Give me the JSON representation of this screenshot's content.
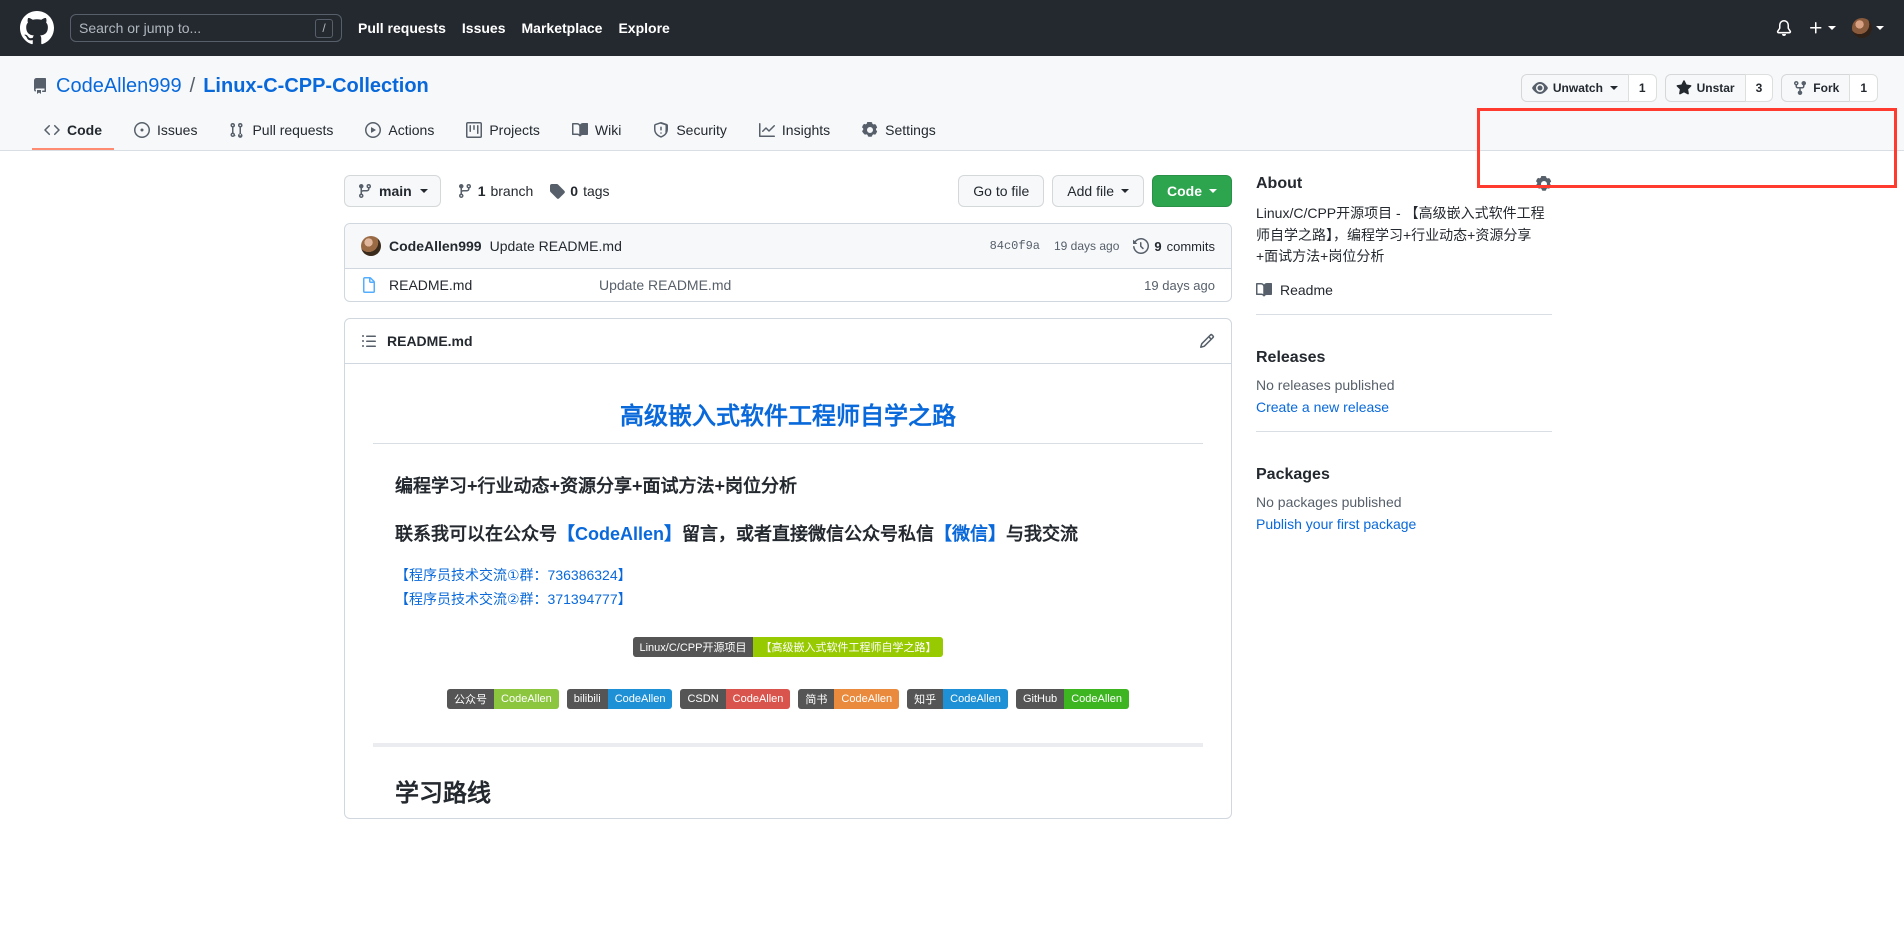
{
  "header": {
    "search_placeholder": "Search or jump to...",
    "slash_key": "/",
    "nav": [
      {
        "label": "Pull requests"
      },
      {
        "label": "Issues"
      },
      {
        "label": "Marketplace"
      },
      {
        "label": "Explore"
      }
    ],
    "icons": {
      "logo": "github-logo-icon",
      "bell": "notifications-bell-icon",
      "plus": "create-new-icon",
      "avatar": "user-avatar"
    }
  },
  "repo": {
    "owner": "CodeAllen999",
    "separator": "/",
    "name": "Linux-C-CPP-Collection",
    "actions": {
      "watch_label": "Unwatch",
      "watch_count": "1",
      "star_label": "Unstar",
      "star_count": "3",
      "fork_label": "Fork",
      "fork_count": "1",
      "annotation_color": "#ff3b30"
    },
    "tabs": [
      {
        "label": "Code",
        "icon": "code-icon",
        "active": true
      },
      {
        "label": "Issues",
        "icon": "issue-opened-icon",
        "active": false
      },
      {
        "label": "Pull requests",
        "icon": "git-pull-request-icon",
        "active": false
      },
      {
        "label": "Actions",
        "icon": "play-icon",
        "active": false
      },
      {
        "label": "Projects",
        "icon": "project-board-icon",
        "active": false
      },
      {
        "label": "Wiki",
        "icon": "book-icon",
        "active": false
      },
      {
        "label": "Security",
        "icon": "shield-icon",
        "active": false
      },
      {
        "label": "Insights",
        "icon": "graph-icon",
        "active": false
      },
      {
        "label": "Settings",
        "icon": "gear-icon",
        "active": false
      }
    ]
  },
  "toolbar": {
    "branch": "main",
    "branch_count": "1",
    "branch_word": "branch",
    "tag_count": "0",
    "tag_word": "tags",
    "go_to_file": "Go to file",
    "add_file": "Add file",
    "code_button": "Code"
  },
  "commit": {
    "author": "CodeAllen999",
    "message": "Update README.md",
    "hash": "84c0f9a",
    "time": "19 days ago",
    "commits_count": "9",
    "commits_word": "commits"
  },
  "files": [
    {
      "name": "README.md",
      "commit": "Update README.md",
      "time": "19 days ago",
      "icon": "file-icon"
    }
  ],
  "readme": {
    "filename": "README.md",
    "list_icon": "list-unordered-icon",
    "edit_icon": "pencil-icon",
    "title": "高级嵌入式软件工程师自学之路",
    "heading_tags": "编程学习+行业动态+资源分享+面试方法+岗位分析",
    "contact": {
      "part1": "联系我可以在公众号",
      "link1": "【CodeAllen】",
      "part2": "留言，或者直接微信公众号私信",
      "link2": "【微信】",
      "part3": "与我交流"
    },
    "qq_groups": [
      "【程序员技术交流①群：736386324】",
      "【程序员技术交流②群：371394777】"
    ],
    "project_badge": {
      "label": "Linux/C/CPP开源项目",
      "value": "【高级嵌入式软件工程师自学之路】",
      "label_color": "#555555",
      "value_color": "#97ca00"
    },
    "social_badges": [
      {
        "label": "公众号",
        "value": "CodeAllen",
        "color": "#8cc63e"
      },
      {
        "label": "bilibili",
        "value": "CodeAllen",
        "color": "#1e90d6"
      },
      {
        "label": "CSDN",
        "value": "CodeAllen",
        "color": "#d9544d"
      },
      {
        "label": "简书",
        "value": "CodeAllen",
        "color": "#ea8a3c"
      },
      {
        "label": "知乎",
        "value": "CodeAllen",
        "color": "#1e90d6"
      },
      {
        "label": "GitHub",
        "value": "CodeAllen",
        "color": "#3cb521"
      }
    ],
    "section_heading": "学习路线"
  },
  "sidebar": {
    "about": {
      "title": "About",
      "gear_icon": "gear-icon",
      "description": "Linux/C/CPP开源项目 - 【高级嵌入式软件工程师自学之路】，编程学习+行业动态+资源分享+面试方法+岗位分析",
      "readme_label": "Readme",
      "readme_icon": "book-icon"
    },
    "releases": {
      "title": "Releases",
      "empty": "No releases published",
      "action": "Create a new release"
    },
    "packages": {
      "title": "Packages",
      "empty": "No packages published",
      "action": "Publish your first package"
    }
  }
}
